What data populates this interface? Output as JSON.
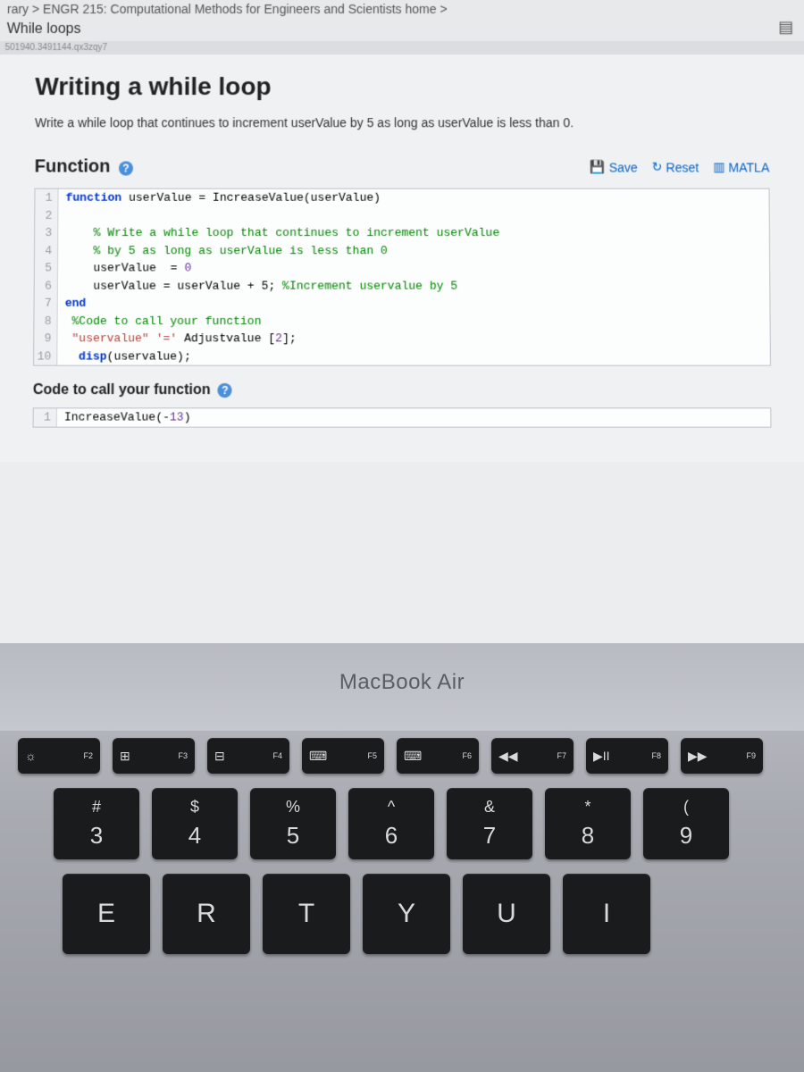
{
  "breadcrumb": "rary > ENGR 215: Computational Methods for Engineers and Scientists home >",
  "sub_breadcrumb": "While loops",
  "id_strip": "501940.3491144.qx3zqy7",
  "title": "Writing a while loop",
  "prompt": "Write a while loop that continues to increment userValue by 5 as long as userValue is less than 0.",
  "section1": "Function",
  "toolbar": {
    "save": "Save",
    "reset": "Reset",
    "docs": "MATLA"
  },
  "code1": {
    "lines": [
      {
        "n": "1",
        "t": "function userValue = IncreaseValue(userValue)",
        "cls": "kw-line"
      },
      {
        "n": "2",
        "t": ""
      },
      {
        "n": "3",
        "t": "    % Write a while loop that continues to increment userValue",
        "cls": "cm"
      },
      {
        "n": "4",
        "t": "    % by 5 as long as userValue is less than 0",
        "cls": "cm"
      },
      {
        "n": "5",
        "t": "    userValue  = 0"
      },
      {
        "n": "6",
        "t": "    userValue = userValue + 5; %Increment uservalue by 5"
      },
      {
        "n": "7",
        "t": "end",
        "cls": "kw"
      },
      {
        "n": "8",
        "t": " %Code to call your function",
        "cls": "cm"
      },
      {
        "n": "9",
        "t": " \"uservalue\" '=' Adjustvalue [2];"
      },
      {
        "n": "10",
        "t": "  disp(uservalue);"
      }
    ]
  },
  "section2": "Code to call your function",
  "code2": {
    "lines": [
      {
        "n": "1",
        "t": "IncreaseValue(-13)"
      }
    ]
  },
  "laptop_label": "MacBook Air",
  "fkeys": [
    {
      "icon": "☼",
      "label": "F2"
    },
    {
      "icon": "⊞",
      "label": "F3"
    },
    {
      "icon": "⊟",
      "label": "F4"
    },
    {
      "icon": "⌨",
      "label": "F5"
    },
    {
      "icon": "⌨",
      "label": "F6"
    },
    {
      "icon": "◀◀",
      "label": "F7"
    },
    {
      "icon": "▶II",
      "label": "F8"
    },
    {
      "icon": "▶▶",
      "label": "F9"
    }
  ],
  "numkeys": [
    {
      "top": "#",
      "bot": "3"
    },
    {
      "top": "$",
      "bot": "4"
    },
    {
      "top": "%",
      "bot": "5"
    },
    {
      "top": "^",
      "bot": "6"
    },
    {
      "top": "&",
      "bot": "7"
    },
    {
      "top": "*",
      "bot": "8"
    },
    {
      "top": "(",
      "bot": "9"
    }
  ],
  "letkeys": [
    "E",
    "R",
    "T",
    "Y",
    "U",
    "I"
  ]
}
